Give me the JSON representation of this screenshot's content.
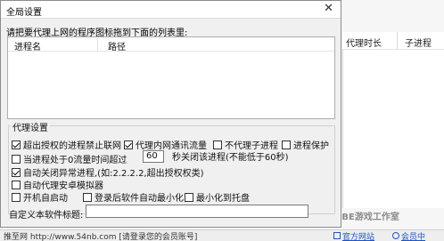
{
  "background": {
    "columns": [
      "代理时长",
      "子进程"
    ],
    "status_url": "推至网 http://www.54nb.com [请登录您的会员账号]",
    "official_site_label": "官方网站",
    "member_center_label": "会员中"
  },
  "watermark": {
    "text": "NBE游戏工作室"
  },
  "dialog": {
    "title": "全局设置",
    "close_glyph": "✕",
    "instruction": "请把要代理上网的程序图标拖到下面的列表里:",
    "list_headers": {
      "process_name": "进程名",
      "path": "路径"
    },
    "group_title": "代理设置",
    "options": {
      "ban_overlimit": {
        "label": "超出授权的进程禁止联网",
        "checked": true
      },
      "proxy_lan": {
        "label": "代理内网通讯流量",
        "checked": true
      },
      "no_proxy_child": {
        "label": "不代理子进程",
        "checked": false
      },
      "process_protect": {
        "label": "进程保护",
        "checked": false
      },
      "idle_close_prefix": {
        "label": "当进程处于0流量时间超过",
        "checked": false
      },
      "idle_close_value": "60",
      "idle_close_suffix": "秒关闭该进程(不能低于60秒)",
      "auto_close_abnormal": {
        "label": "自动关闭异常进程,(如:2.2.2.2,超出授权权类)",
        "checked": true
      },
      "auto_proxy_emulator": {
        "label": "自动代理安卓模拟器",
        "checked": false
      },
      "auto_start": {
        "label": "开机自启动",
        "checked": false
      },
      "min_after_login": {
        "label": "登录后软件自动最小化",
        "checked": false
      },
      "min_to_tray": {
        "label": "最小化到托盘",
        "checked": false
      }
    },
    "custom_title_label": "自定义本软件标题:",
    "custom_title_value": ""
  }
}
